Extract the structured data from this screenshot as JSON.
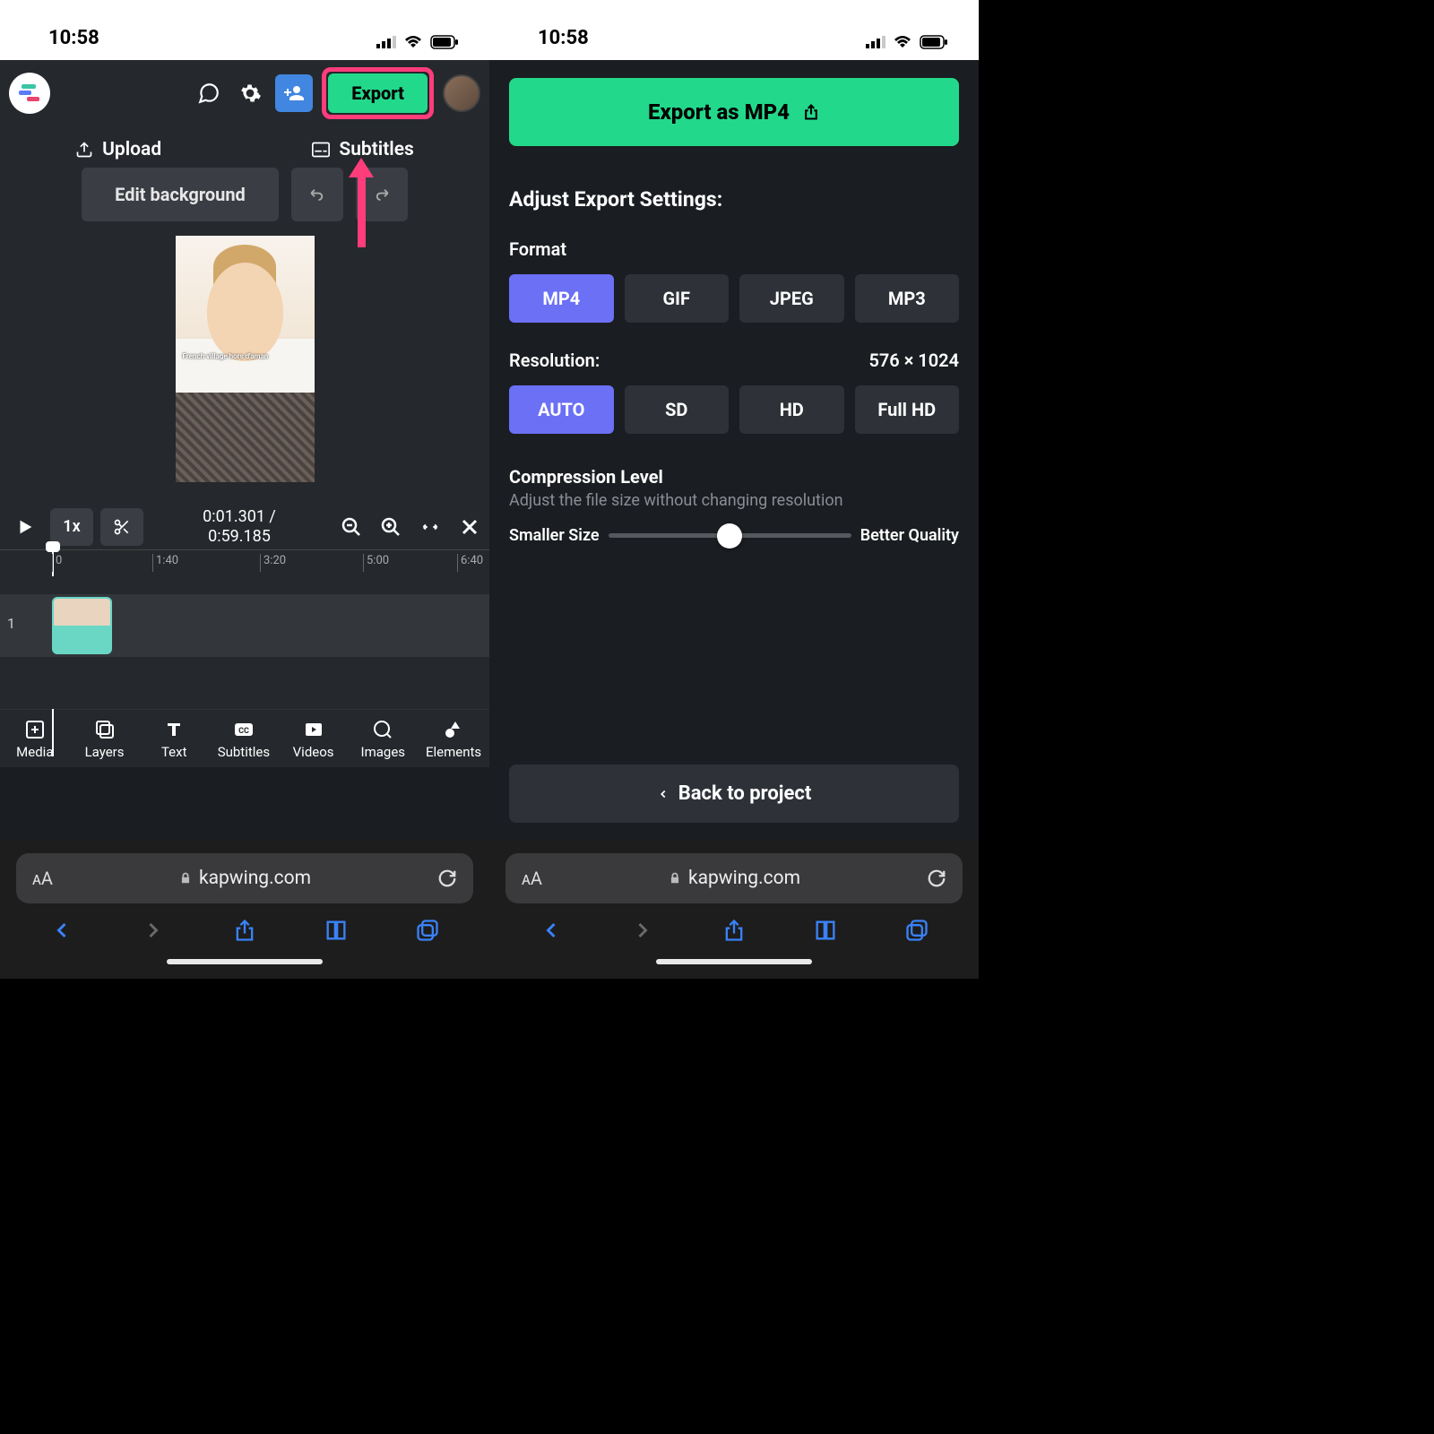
{
  "status": {
    "time": "10:58"
  },
  "left": {
    "export": "Export",
    "upload": "Upload",
    "subtitles": "Subtitles",
    "edit_bg": "Edit background",
    "caption": "French village\nhors d'aman",
    "speed": "1x",
    "time_current": "0:01.301",
    "time_sep": "/",
    "time_total": "0:59.185",
    "track_num": "1",
    "ticks": [
      "0",
      "1:40",
      "3:20",
      "5:00",
      "6:40"
    ],
    "tabs": [
      "Media",
      "Layers",
      "Text",
      "Subtitles",
      "Videos",
      "Images",
      "Elements"
    ],
    "url": "kapwing.com"
  },
  "right": {
    "export_as": "Export as MP4",
    "adjust": "Adjust Export Settings:",
    "format_label": "Format",
    "formats": [
      "MP4",
      "GIF",
      "JPEG",
      "MP3"
    ],
    "format_active": 0,
    "res_label": "Resolution:",
    "res_value": "576 × 1024",
    "resolutions": [
      "AUTO",
      "SD",
      "HD",
      "Full HD"
    ],
    "res_active": 0,
    "comp_title": "Compression Level",
    "comp_sub": "Adjust the file size without changing resolution",
    "slider_left": "Smaller Size",
    "slider_right": "Better Quality",
    "back": "Back to project",
    "url": "kapwing.com"
  }
}
